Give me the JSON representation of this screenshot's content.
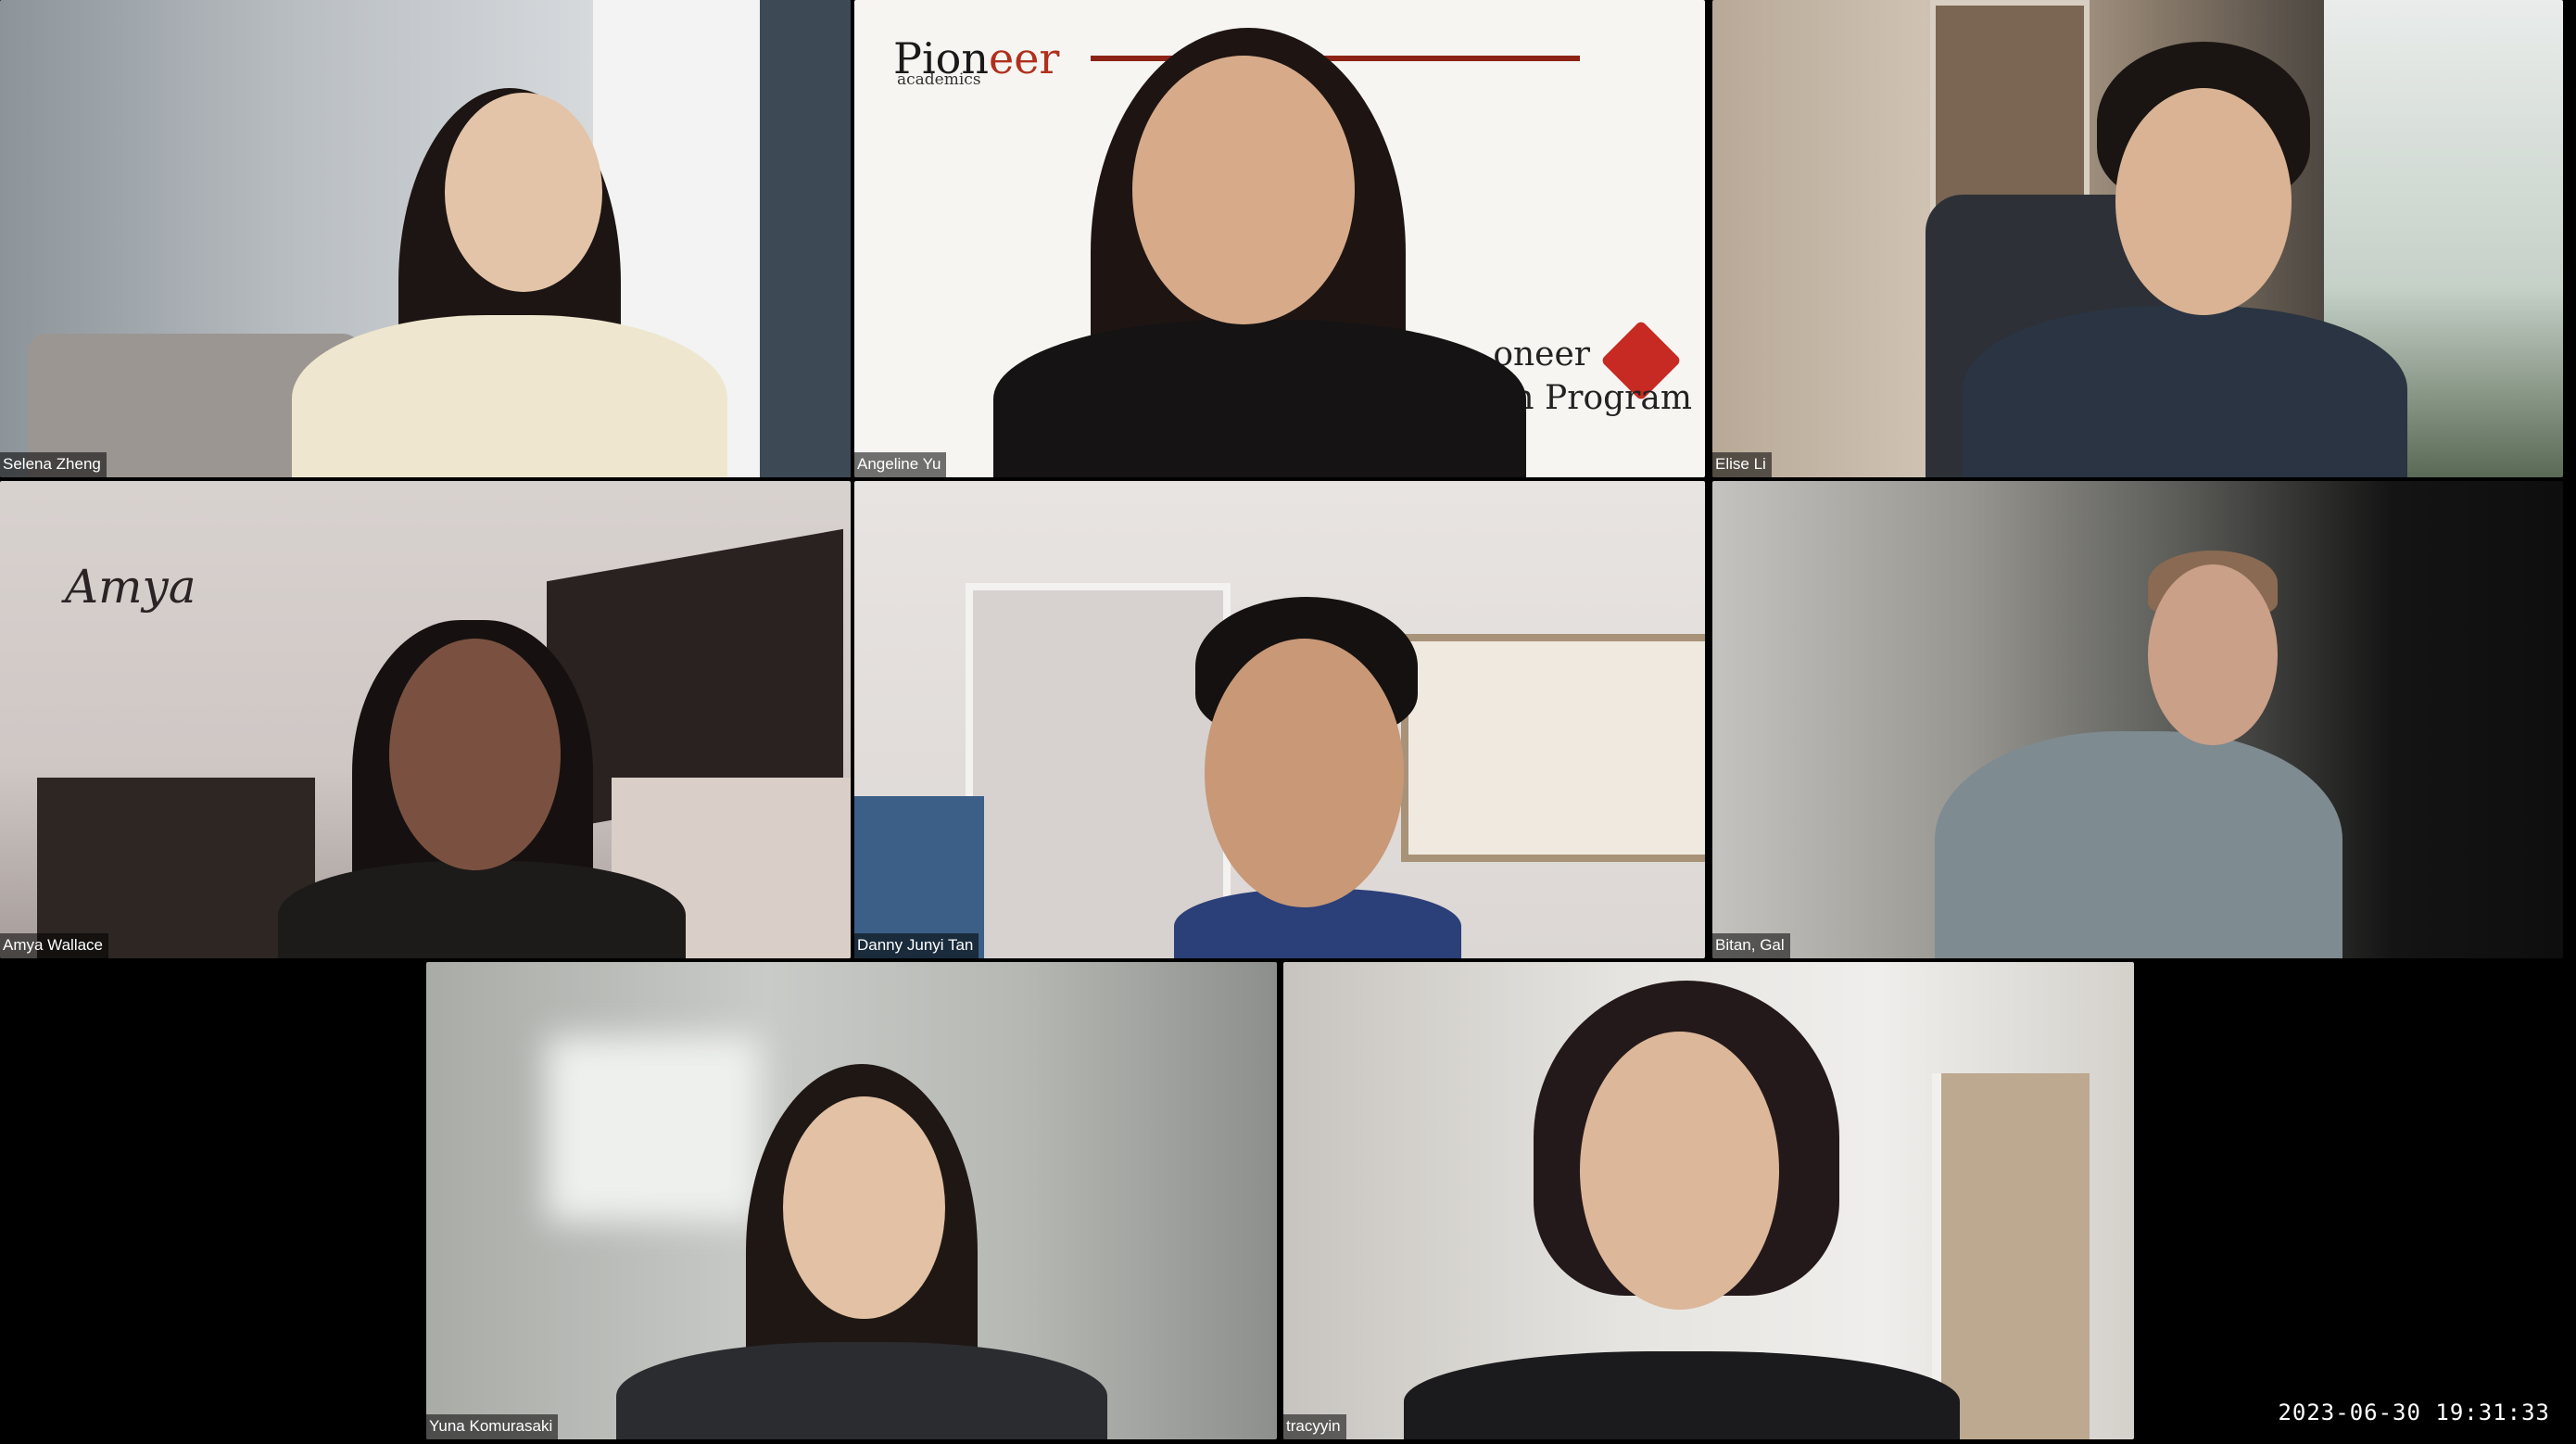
{
  "participants": [
    {
      "name": "Selena Zheng"
    },
    {
      "name": "Angeline Yu"
    },
    {
      "name": "Elise Li"
    },
    {
      "name": "Amya Wallace"
    },
    {
      "name": "Danny Junyi Tan"
    },
    {
      "name": "Bitan, Gal"
    },
    {
      "name": "Yuna Komurasaki"
    },
    {
      "name": "tracyyin"
    }
  ],
  "background": {
    "pioneer_logo_main": "Pion",
    "pioneer_logo_accent": "eer",
    "pioneer_logo_sub": "academics",
    "pioneer_back_line1": "oneer",
    "pioneer_back_line2": "h Program",
    "wall_name": "Amya"
  },
  "timestamp": "2023-06-30 19:31:33",
  "colors": {
    "background": "#000000",
    "pioneer_red": "#b0301e"
  }
}
